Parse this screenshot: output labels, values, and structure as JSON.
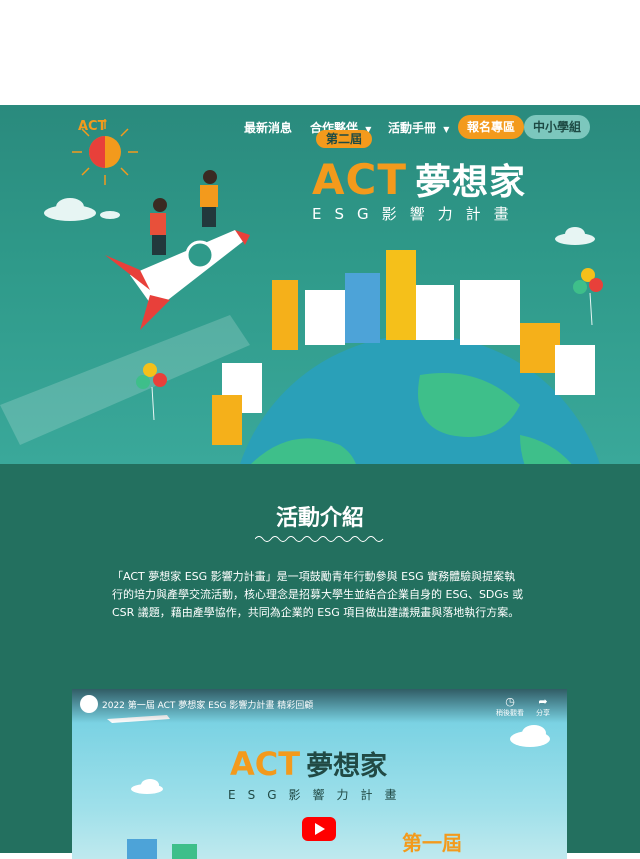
{
  "nav": {
    "items": [
      {
        "label": "最新消息"
      },
      {
        "label": "合作夥伴",
        "dropdown": true
      },
      {
        "label": "活動手冊",
        "dropdown": true
      }
    ],
    "register_label": "報名專區",
    "school_label": "中小學組"
  },
  "hero": {
    "logo_text": "ACT",
    "badge": "第二屆",
    "title_en": "ACT",
    "title_cn": "夢想家",
    "subtitle": "ESG影響力計畫"
  },
  "intro": {
    "heading": "活動介紹",
    "body": "「ACT 夢想家 ESG 影響力計畫」是一項鼓勵青年行動參與 ESG 實務體驗與提案執行的培力與產學交流活動，核心理念是招募大學生並結合企業自身的 ESG、SDGs 或 CSR 議題，藉由產學協作，共同為企業的 ESG 項目做出建議規畫與落地執行方案。"
  },
  "video": {
    "title": "2022 第一屆 ACT 夢想家 ESG 影響力計畫 精彩回顧",
    "watch_later": "稍後觀看",
    "share": "分享",
    "thumb_title_en": "ACT",
    "thumb_title_cn": "夢想家",
    "thumb_subtitle": "ESG影響力計畫",
    "thumb_edition": "第一屆"
  },
  "colors": {
    "accent": "#f39a1c",
    "hero_bg": "#2f9a8a",
    "intro_bg": "#23705f",
    "school_pill": "#7cc7bd"
  }
}
